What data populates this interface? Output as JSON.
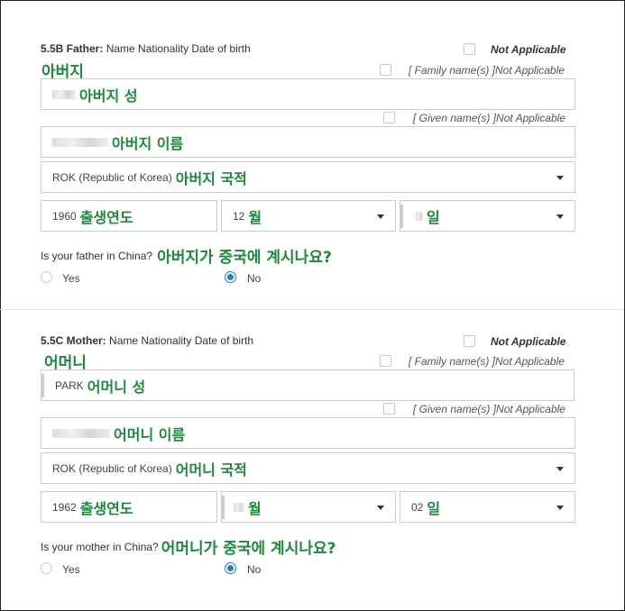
{
  "father": {
    "title_bold": "5.5B Father:",
    "title_rest": " Name Nationality Date of birth",
    "not_applicable": "Not Applicable",
    "annot": "아버지",
    "family_na": "[ Family name(s) ]Not Applicable",
    "given_na": "[ Given name(s) ]Not Applicable",
    "surname_annot": "아버지 성",
    "given_annot": "아버지 이름",
    "nationality_value": "ROK (Republic of Korea)",
    "nationality_annot": "아버지 국적",
    "year_value": "1960",
    "year_annot": "출생연도",
    "month_value": "12",
    "month_annot": "월",
    "day_annot": "일",
    "question": "Is your father in China?",
    "question_annot": "아버지가 중국에 계시나요?",
    "yes_label": "Yes",
    "no_label": "No",
    "selected": "No"
  },
  "mother": {
    "title_bold": "5.5C Mother:",
    "title_rest": " Name Nationality Date of birth",
    "not_applicable": "Not Applicable",
    "annot": "어머니",
    "family_na": "[ Family name(s) ]Not Applicable",
    "given_na": "[ Given name(s) ]Not Applicable",
    "surname_value": "PARK",
    "surname_annot": "어머니 성",
    "given_annot": "어머니 이름",
    "nationality_value": "ROK (Republic of Korea)",
    "nationality_annot": "어머니 국적",
    "year_value": "1962",
    "year_annot": "출생연도",
    "month_annot": "월",
    "day_value": "02",
    "day_annot": "일",
    "question": "Is your mother in China?",
    "question_annot": "어머니가 중국에 계시나요?",
    "yes_label": "Yes",
    "no_label": "No",
    "selected": "No"
  },
  "colors": {
    "annotation": "#1b8a3a",
    "radio_selected": "#2b7cd3",
    "border": "#cccccc"
  }
}
